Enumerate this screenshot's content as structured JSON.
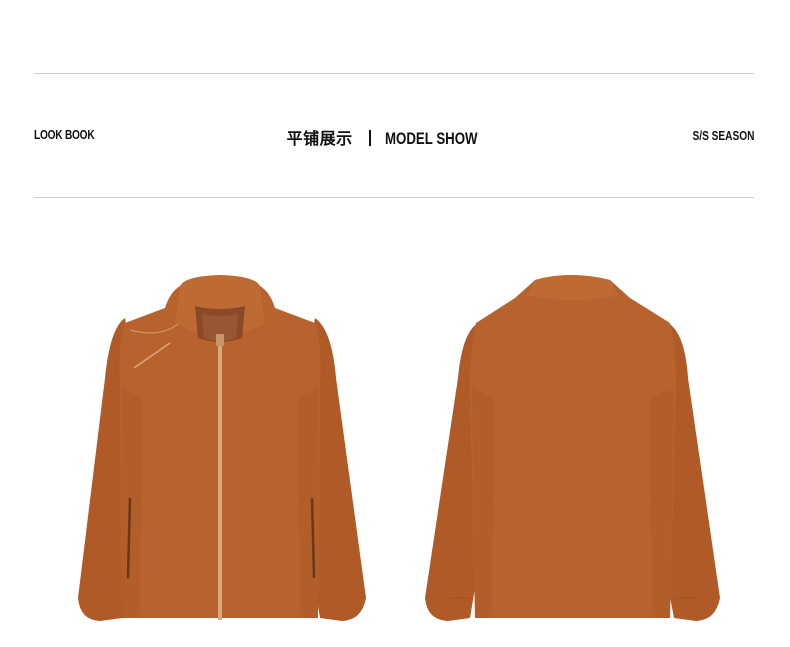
{
  "header": {
    "left_label": "LOOK BOOK",
    "center_cn": "平铺展示",
    "center_en": "MODEL SHOW",
    "right_label": "S/S SEASON"
  },
  "products": [
    {
      "view": "front",
      "color": "#B8622D"
    },
    {
      "view": "back",
      "color": "#B8622D"
    }
  ],
  "colors": {
    "jacket_main": "#B8622D",
    "jacket_shadow": "#9E5224",
    "zipper": "#D8A97E",
    "lining": "#8A4A2A",
    "rule": "#CFCFCF"
  }
}
